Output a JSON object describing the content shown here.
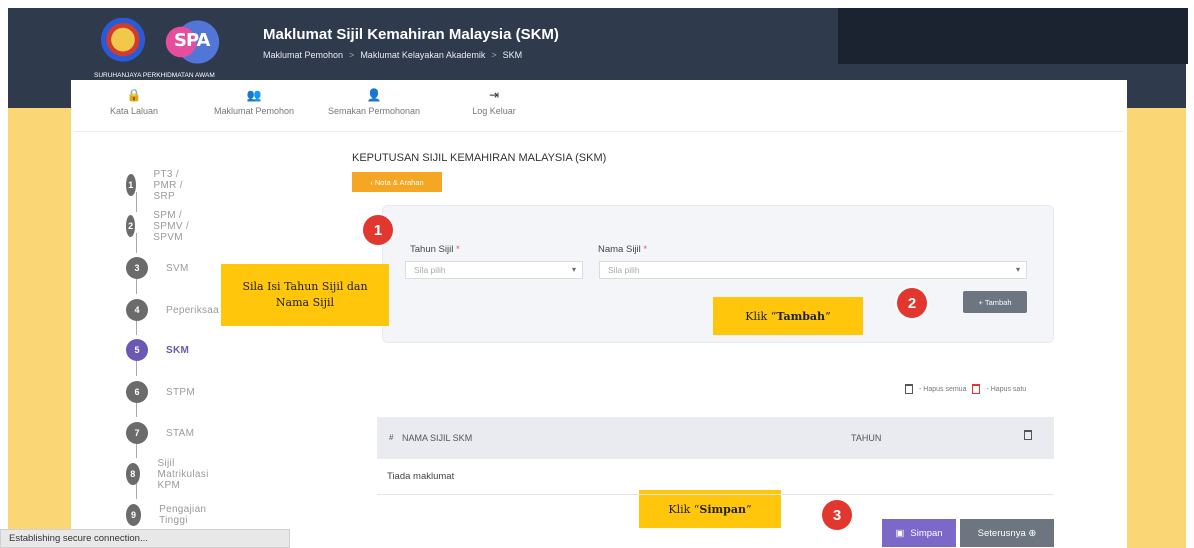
{
  "header": {
    "agency_name": "SURUHANJAYA PERKHIDMATAN AWAM",
    "logo_text": "SPA",
    "title": "Maklumat Sijil Kemahiran Malaysia (SKM)",
    "breadcrumb": [
      "Maklumat Pemohon",
      "Maklumat Kelayakan Akademik",
      "SKM"
    ],
    "breadcrumb_sep": ">"
  },
  "nav": {
    "items": [
      {
        "label": "Kata Laluan",
        "icon": "lock-icon",
        "glyph": "🔒"
      },
      {
        "label": "Maklumat Pemohon",
        "icon": "users-icon",
        "glyph": "👥"
      },
      {
        "label": "Semakan Permohonan",
        "icon": "user-check-icon",
        "glyph": "👤"
      },
      {
        "label": "Log Keluar",
        "icon": "sign-out-icon",
        "glyph": "⇥"
      }
    ]
  },
  "steps": [
    {
      "num": "1",
      "label": "PT3 / PMR / SRP"
    },
    {
      "num": "2",
      "label": "SPM / SPMV / SPVM"
    },
    {
      "num": "3",
      "label": "SVM"
    },
    {
      "num": "4",
      "label": "Peperiksaa"
    },
    {
      "num": "5",
      "label": "SKM"
    },
    {
      "num": "6",
      "label": "STPM"
    },
    {
      "num": "7",
      "label": "STAM"
    },
    {
      "num": "8",
      "label": "Sijil Matrikulasi KPM"
    },
    {
      "num": "9",
      "label": "Pengajian Tinggi"
    }
  ],
  "section": {
    "title": "KEPUTUSAN SIJIL KEMAHIRAN MALAYSIA (SKM)",
    "nota_button": "‹ Nota & Arahan"
  },
  "form": {
    "tahun_label": "Tahun Sijil",
    "nama_label": "Nama Sijil",
    "required_mark": "*",
    "tahun_placeholder": "Sila pilih",
    "nama_placeholder": "Sila pilih",
    "tambah_button": "+ Tambah"
  },
  "annotations": {
    "badge1": "1",
    "badge2": "2",
    "badge3": "3",
    "note1": "Sila Isi Tahun Sijil dan Nama Sijil",
    "note2_prefix": "Klik “",
    "note2_bold": "Tambah",
    "note2_suffix": "”",
    "note3_prefix": "Klik “",
    "note3_bold": "Simpan",
    "note3_suffix": "”"
  },
  "legend": {
    "hapus_semua": "- Hapus semua",
    "hapus_satu": "- Hapus satu"
  },
  "table": {
    "headers": {
      "hash": "#",
      "name": "NAMA SIJIL SKM",
      "tahun": "TAHUN"
    },
    "empty_text": "Tiada maklumat"
  },
  "actions": {
    "simpan": "Simpan",
    "seterusnya": "Seterusnya ⊕"
  },
  "status_bar": "Establishing secure connection...",
  "colors": {
    "header_bg": "#2f3a4c",
    "page_bg": "#fbd674",
    "accent_purple": "#6b57b4",
    "badge_red": "#e2372f",
    "note_yellow": "#ffc60b",
    "nota_orange": "#f5a623"
  }
}
